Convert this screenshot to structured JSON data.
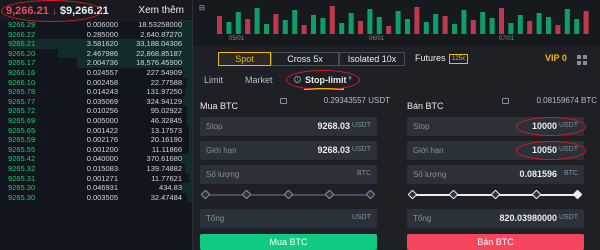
{
  "ticker": {
    "price": "9,266.21",
    "arrow": "↓",
    "usd": "$9,266.21",
    "more_label": "Xem thêm"
  },
  "orderbook": [
    {
      "price": "9266.29",
      "amount": "0.006000",
      "total": "18.53258000",
      "depth": 0.08
    },
    {
      "price": "9266.22",
      "amount": "0.285000",
      "total": "2,640.87270",
      "depth": 0.15
    },
    {
      "price": "9266.21",
      "amount": "3.581620",
      "total": "33,188.04306",
      "depth": 0.95
    },
    {
      "price": "9266.20",
      "amount": "2.467986",
      "total": "22,868.85187",
      "depth": 0.7
    },
    {
      "price": "9266.17",
      "amount": "2.004736",
      "total": "18,576.45900",
      "depth": 0.6
    },
    {
      "price": "9266.16",
      "amount": "0.024557",
      "total": "227.54909",
      "depth": 0.05
    },
    {
      "price": "9266.10",
      "amount": "0.002458",
      "total": "22.77588",
      "depth": 0.03
    },
    {
      "price": "9265.78",
      "amount": "0.014243",
      "total": "131.97250",
      "depth": 0.04
    },
    {
      "price": "9265.77",
      "amount": "0.035069",
      "total": "324.94129",
      "depth": 0.05
    },
    {
      "price": "9265.72",
      "amount": "0.010256",
      "total": "95.02922",
      "depth": 0.03
    },
    {
      "price": "9265.69",
      "amount": "0.005000",
      "total": "46.32845",
      "depth": 0.03
    },
    {
      "price": "9265.65",
      "amount": "0.001422",
      "total": "13.17573",
      "depth": 0.02
    },
    {
      "price": "9265.59",
      "amount": "0.002176",
      "total": "20.16190",
      "depth": 0.02
    },
    {
      "price": "9265.55",
      "amount": "0.001200",
      "total": "11.11866",
      "depth": 0.02
    },
    {
      "price": "9265.42",
      "amount": "0.040000",
      "total": "370.61680",
      "depth": 0.06
    },
    {
      "price": "9265.32",
      "amount": "0.015083",
      "total": "139.74882",
      "depth": 0.04
    },
    {
      "price": "9265.31",
      "amount": "0.001271",
      "total": "11.77621",
      "depth": 0.02
    },
    {
      "price": "9265.30",
      "amount": "0.046931",
      "total": "434.83",
      "depth": 0.06
    },
    {
      "price": "9265.30",
      "amount": "0.003505",
      "total": "32.47484",
      "depth": 0.03
    }
  ],
  "chart": {
    "dates": [
      "05/01",
      "06/01",
      "07/01"
    ]
  },
  "mode_tabs": [
    "Spot",
    "Cross 5x",
    "Isolated 10x"
  ],
  "futures": {
    "label": "Futures",
    "leverage": "125x"
  },
  "vip": "VIP 0",
  "order_types": {
    "limit": "Limit",
    "market": "Market",
    "stop_limit": "Stop-limit"
  },
  "buy": {
    "title": "Mua BTC",
    "balance": "0.29343557 USDT",
    "stop_label": "Stop",
    "stop_value": "9268.03",
    "stop_unit": "USDT",
    "limit_label": "Giới hạn",
    "limit_value": "9268.03",
    "limit_unit": "USDT",
    "amount_label": "Số lượng",
    "amount_value": "",
    "amount_unit": "BTC",
    "total_label": "Tổng",
    "total_value": "",
    "total_unit": "USDT",
    "button": "Mua BTC"
  },
  "sell": {
    "title": "Bán BTC",
    "balance": "0.08159674 BTC",
    "stop_label": "Stop",
    "stop_value": "10000",
    "stop_unit": "USDT",
    "limit_label": "Giới hạn",
    "limit_value": "10050",
    "limit_unit": "USDT",
    "amount_label": "Số lượng",
    "amount_value": "0.081596",
    "amount_unit": "BTC",
    "total_label": "Tổng",
    "total_value": "820.03980000",
    "total_unit": "USDT",
    "button": "Bán BTC"
  },
  "colors": {
    "accent": "#f0b90b",
    "buy": "#0ecb81",
    "sell": "#f6465d",
    "annotation": "#e0171f"
  }
}
